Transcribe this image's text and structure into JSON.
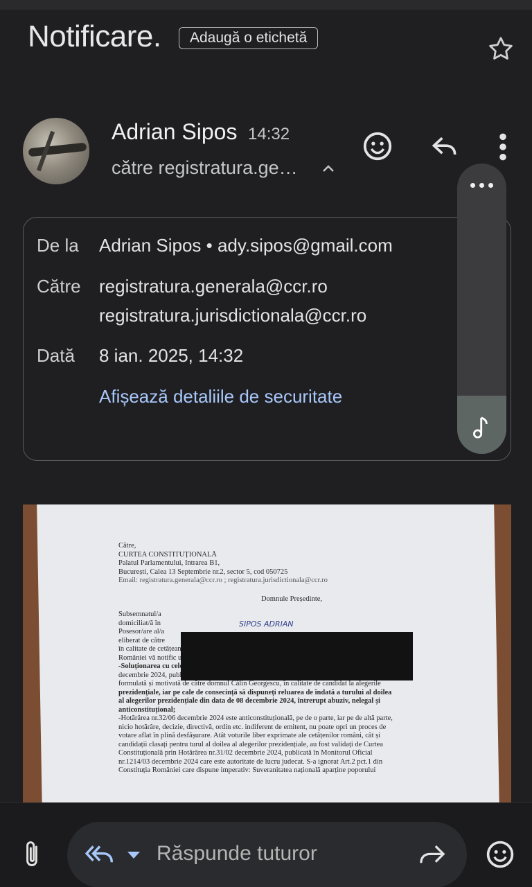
{
  "header": {
    "subject": "Notificare.",
    "add_label": "Adaugă o etichetă",
    "star_icon": "star-outline-icon"
  },
  "message": {
    "sender_name": "Adrian Sipos",
    "time": "14:32",
    "to_summary": "către registratura.ge…",
    "actions": [
      "emoji-reaction-icon",
      "reply-icon",
      "more-vert-icon"
    ]
  },
  "details": {
    "from_label": "De la",
    "from_value": "Adrian Sipos • ady.sipos@gmail.com",
    "to_label": "Către",
    "to_value_1": "registratura.generala@ccr.ro",
    "to_value_2": "registratura.jurisdictionala@ccr.ro",
    "date_label": "Dată",
    "date_value": "8 ian. 2025, 14:32",
    "security_link": "Afișează detaliile de securitate"
  },
  "attachment_doc": {
    "lines_header": [
      "Către,",
      "CURTEA CONSTITUȚIONALĂ",
      "Palatul Parlamentului, Intrarea B1,",
      "București, Calea 13 Septembrie nr.2, sector 5, cod 050725",
      "Email: registratura.generala@ccr.ro ;  registratura.jurisdictionala@ccr.ro"
    ],
    "salutation": "Domnule Președinte,",
    "lines_body": [
      "Subsemnatul/a",
      "domiciliat/ă în",
      "Posesor/are al/a",
      "eliberat de către",
      "în calitate de cetățean al României",
      "României vă notific următoarele:",
      "-Soluționarea cu celeritate a cererii de revizuire a Hotărârii Curții Constituționale nr.32/06",
      "decembrie 2024, publicată în Monitorul Oficial nr.1231/06 decembrie 2024, așa cum a fost",
      "formulată și motivată de către domnul Călin Georgescu, în calitate de candidat la alegerile",
      "prezidențiale, iar pe cale de consecință să dispuneți reluarea de îndată a turului al doilea",
      "al alegerilor prezidențiale din data de 08 decembrie 2024, întrerupt abuziv, nelegal și",
      "anticonstituțional;",
      "-Hotărârea nr.32/06 decembrie 2024 este anticonstituțională, pe de o parte, iar pe de altă parte,",
      "nicio hotărâre, decizie, directivă, ordin etc. indiferent de emitent, nu poate opri un proces de",
      "votare aflat în plină desfășurare. Atât voturile liber exprimate ale cetățenilor români, cât și",
      "candidații clasați pentru turul al doilea al alegerilor prezidențiale, au fost validați de Curtea",
      "Constituțională prin Hotărârea nr.31/02 decembrie 2024, publicată în Monitorul Oficial",
      "nr.1214/03 decembrie 2024 care este autoritate de lucru judecat. S-a ignorat Art.2 pct.1 din",
      "Constituția României care dispune imperativ: Suveranitatea națională aparține poporului"
    ],
    "handwritten_name": "SIPOS ADRIAN"
  },
  "bottom": {
    "attach_icon": "paperclip-icon",
    "reply_all_icon": "reply-all-icon",
    "reply_placeholder": "Răspunde tuturor",
    "forward_icon": "forward-icon",
    "emoji_icon": "emoji-icon"
  },
  "colors": {
    "background": "#1f1f21",
    "link": "#a8c7fa",
    "overlay": "#3c3c3e"
  }
}
